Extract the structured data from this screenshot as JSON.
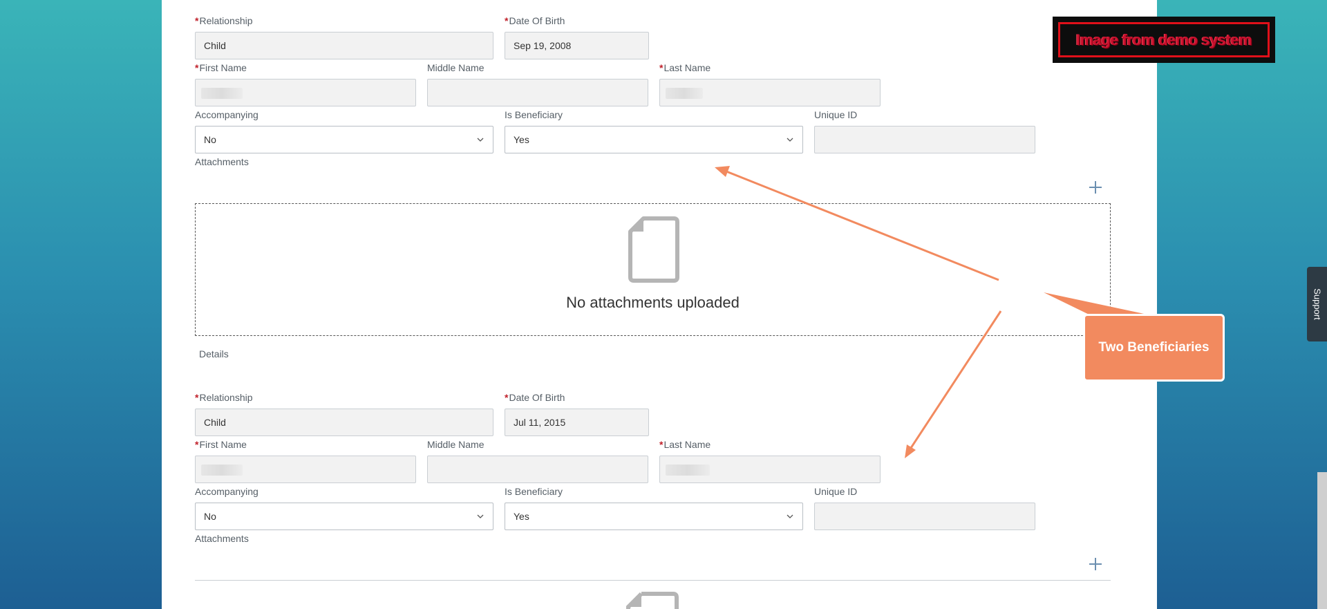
{
  "demo_badge": "Image from demo system",
  "callout": "Two Beneficiaries",
  "support": "Support",
  "required_mark": "*",
  "beneficiaries": [
    {
      "relationship_label": "Relationship",
      "relationship_value": "Child",
      "dob_label": "Date Of Birth",
      "dob_value": "Sep 19, 2008",
      "first_name_label": "First Name",
      "middle_name_label": "Middle Name",
      "last_name_label": "Last Name",
      "accompanying_label": "Accompanying",
      "accompanying_value": "No",
      "is_beneficiary_label": "Is Beneficiary",
      "is_beneficiary_value": "Yes",
      "unique_id_label": "Unique ID",
      "attachments_label": "Attachments",
      "no_attachments": "No attachments uploaded"
    },
    {
      "section_title": "Details",
      "relationship_label": "Relationship",
      "relationship_value": "Child",
      "dob_label": "Date Of Birth",
      "dob_value": "Jul 11, 2015",
      "first_name_label": "First Name",
      "middle_name_label": "Middle Name",
      "last_name_label": "Last Name",
      "accompanying_label": "Accompanying",
      "accompanying_value": "No",
      "is_beneficiary_label": "Is Beneficiary",
      "is_beneficiary_value": "Yes",
      "unique_id_label": "Unique ID",
      "attachments_label": "Attachments"
    }
  ],
  "colors": {
    "required": "#c0202a",
    "callout": "#f28a5f",
    "demo_border": "#e0101a"
  },
  "icons": {
    "select": "chevron-down-icon",
    "add": "plus-icon",
    "empty": "document-icon"
  }
}
